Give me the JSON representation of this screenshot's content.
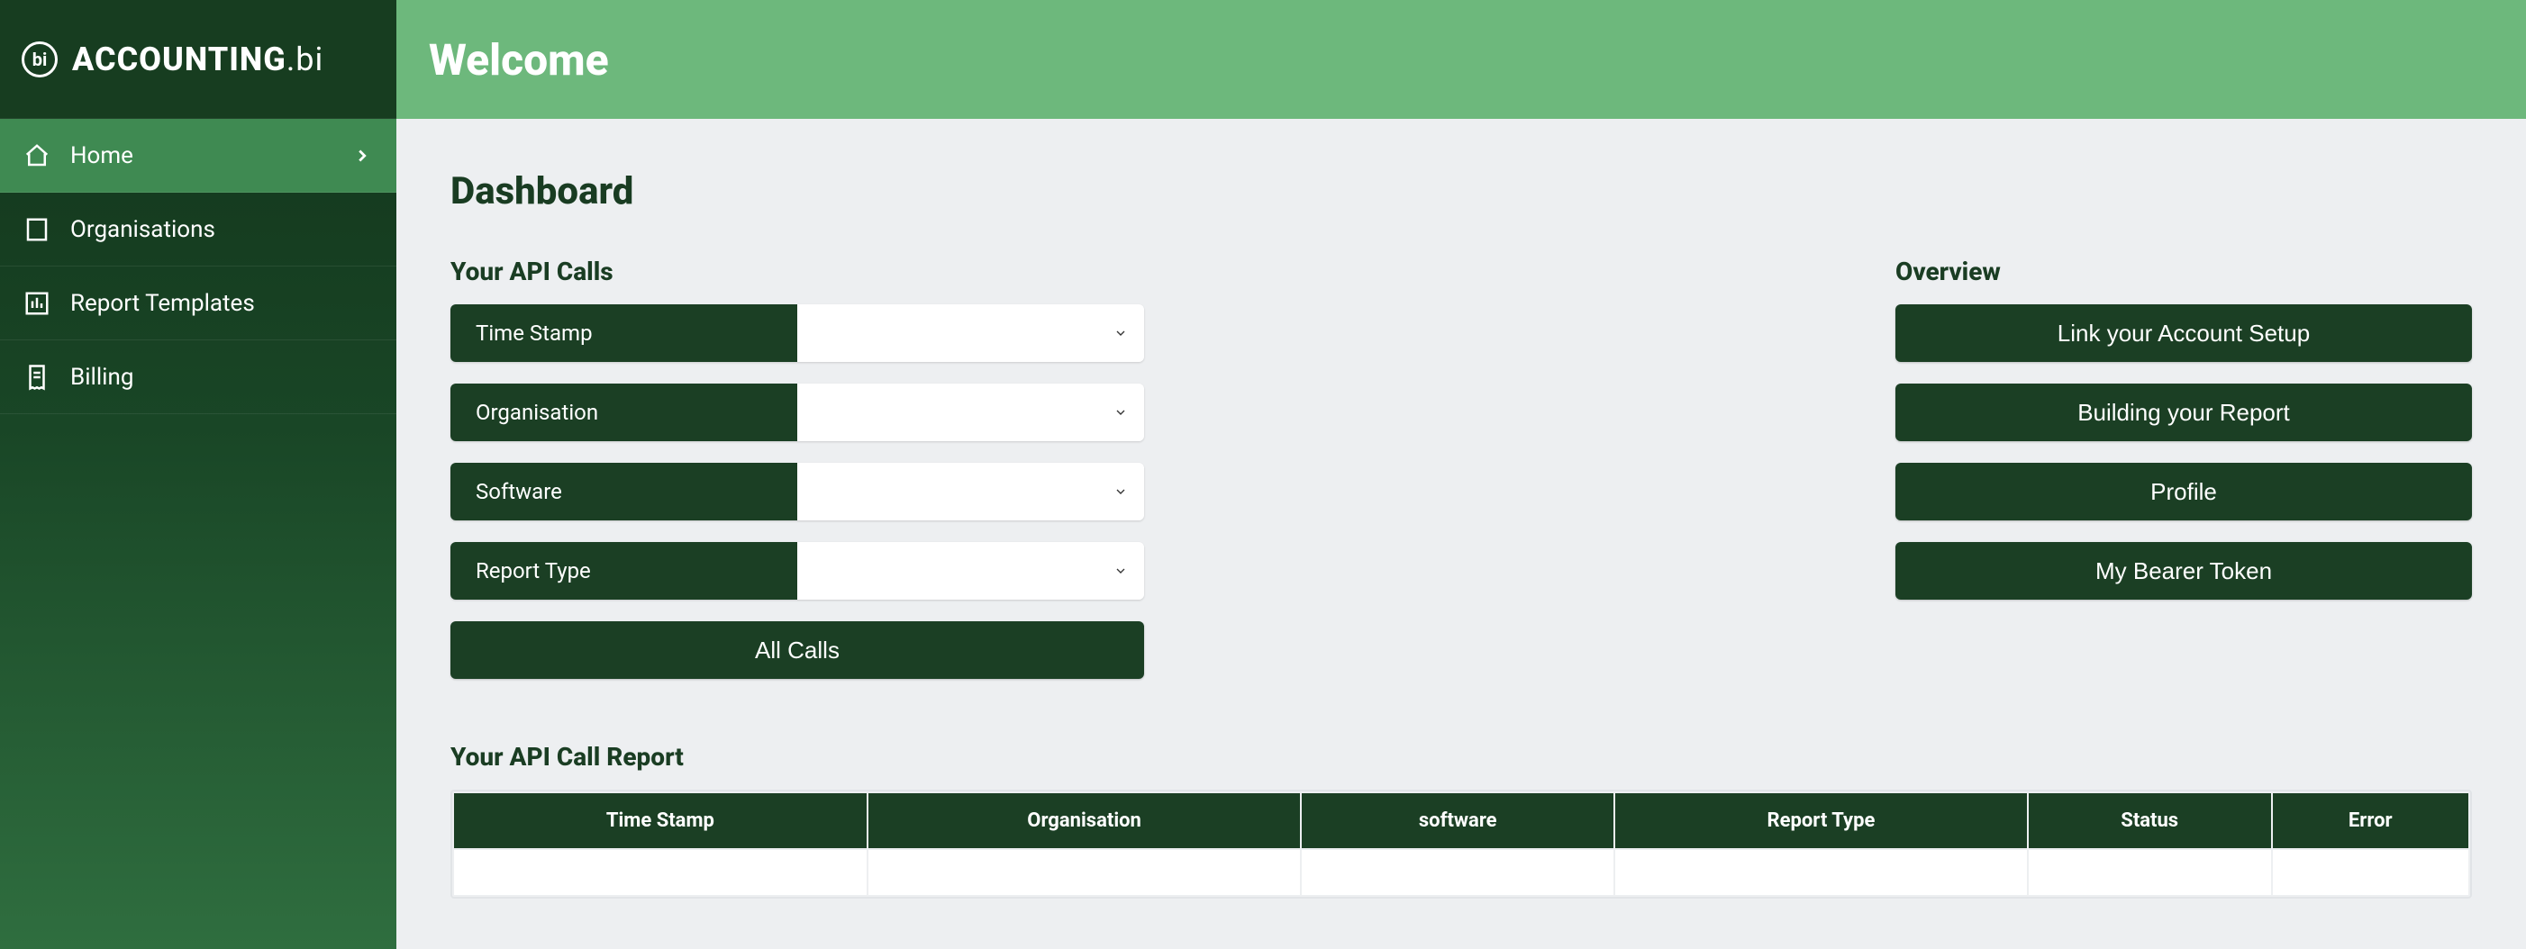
{
  "brand": {
    "name": "ACCOUNTING",
    "suffix": ".bi",
    "logo_letter": "bi"
  },
  "header": {
    "title": "Welcome"
  },
  "sidebar": {
    "items": [
      {
        "id": "home",
        "label": "Home",
        "icon": "home-icon",
        "active": true
      },
      {
        "id": "organisations",
        "label": "Organisations",
        "icon": "building-icon",
        "active": false
      },
      {
        "id": "report-templates",
        "label": "Report Templates",
        "icon": "chart-icon",
        "active": false
      },
      {
        "id": "billing",
        "label": "Billing",
        "icon": "receipt-icon",
        "active": false
      }
    ]
  },
  "dashboard": {
    "title": "Dashboard",
    "api_calls": {
      "title": "Your API Calls",
      "filters": [
        {
          "id": "time-stamp",
          "label": "Time Stamp",
          "value": ""
        },
        {
          "id": "organisation",
          "label": "Organisation",
          "value": ""
        },
        {
          "id": "software",
          "label": "Software",
          "value": ""
        },
        {
          "id": "report-type",
          "label": "Report Type",
          "value": ""
        }
      ],
      "all_calls_label": "All Calls"
    },
    "overview": {
      "title": "Overview",
      "items": [
        {
          "id": "link-account",
          "label": "Link your Account Setup"
        },
        {
          "id": "build-report",
          "label": "Building your Report"
        },
        {
          "id": "profile",
          "label": "Profile"
        },
        {
          "id": "bearer-token",
          "label": "My Bearer Token"
        }
      ]
    },
    "report": {
      "title": "Your API Call Report",
      "columns": [
        "Time Stamp",
        "Organisation",
        "software",
        "Report Type",
        "Status",
        "Error"
      ],
      "rows": []
    }
  }
}
